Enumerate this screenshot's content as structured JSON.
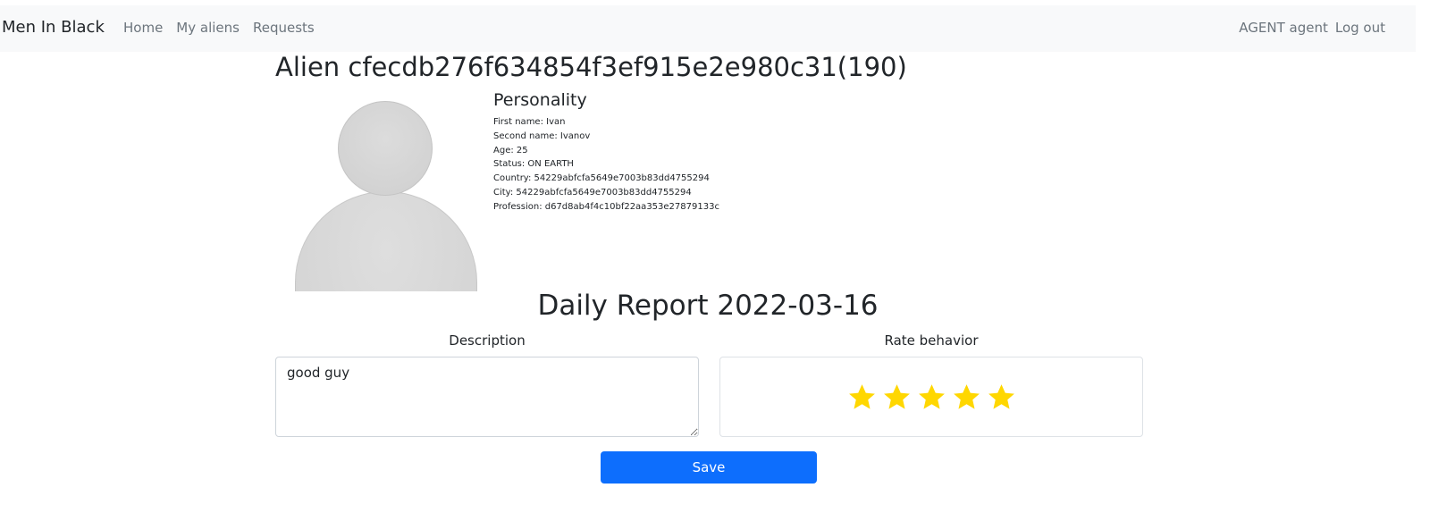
{
  "navbar": {
    "brand": "Men In Black",
    "links": [
      "Home",
      "My aliens",
      "Requests"
    ],
    "user": "AGENT agent",
    "logout": "Log out"
  },
  "alien": {
    "title": "Alien cfecdb276f634854f3ef915e2e980c31(190)",
    "personality_heading": "Personality",
    "info": [
      "First name: Ivan",
      "Second name: Ivanov",
      "Age: 25",
      "Status: ON EARTH",
      "Country: 54229abfcfa5649e7003b83dd4755294",
      "City: 54229abfcfa5649e7003b83dd4755294",
      "Profession: d67d8ab4f4c10bf22aa353e27879133c"
    ]
  },
  "report": {
    "title": "Daily Report 2022-03-16",
    "description_label": "Description",
    "description_value": "good guy",
    "rate_label": "Rate behavior",
    "rating": 5,
    "rating_max": 5,
    "star_color": "#ffd700",
    "save_label": "Save"
  },
  "colors": {
    "navbar_bg": "#f8f9fa",
    "primary": "#0d6efd"
  }
}
